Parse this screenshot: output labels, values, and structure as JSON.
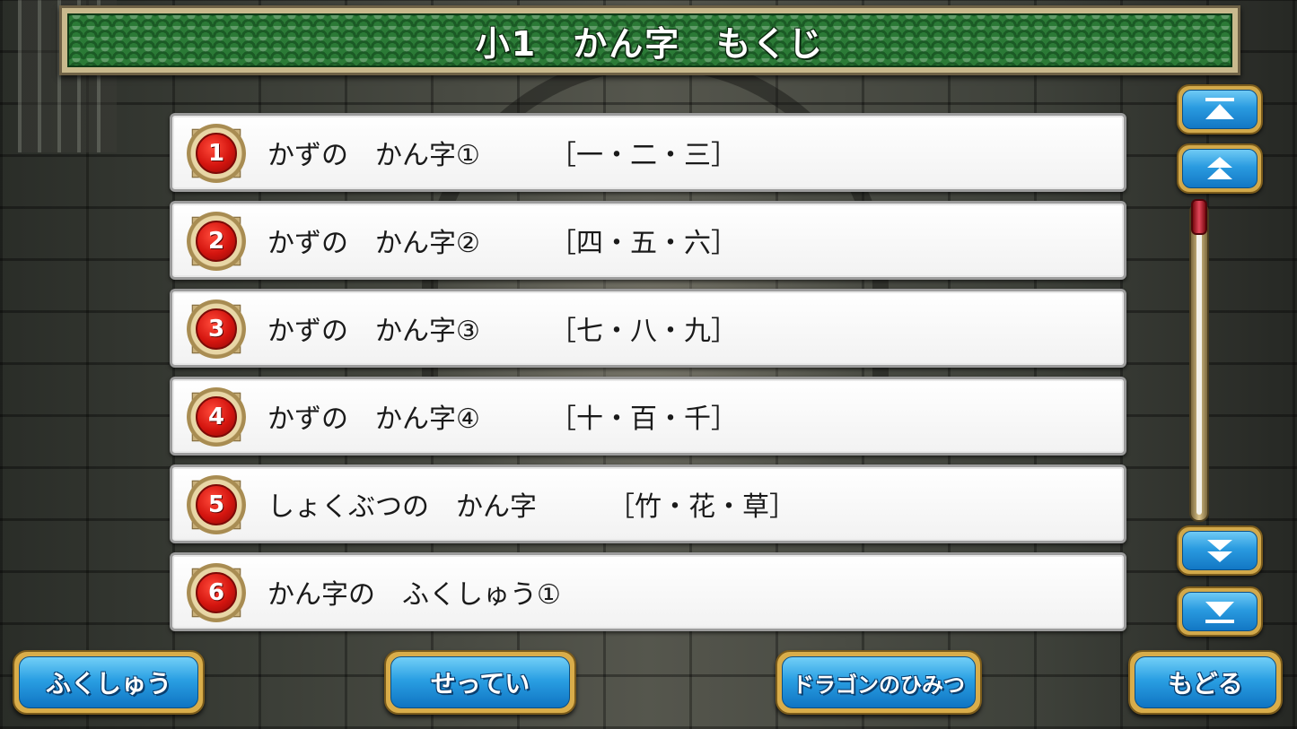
{
  "header": {
    "title": "小1　かん字　もくじ"
  },
  "lessons": [
    {
      "number": "1",
      "title": "かずの　かん字①",
      "kanji": "［一・二・三］"
    },
    {
      "number": "2",
      "title": "かずの　かん字②",
      "kanji": "［四・五・六］"
    },
    {
      "number": "3",
      "title": "かずの　かん字③",
      "kanji": "［七・八・九］"
    },
    {
      "number": "4",
      "title": "かずの　かん字④",
      "kanji": "［十・百・千］"
    },
    {
      "number": "5",
      "title": "しょくぶつの　かん字",
      "kanji": "［竹・花・草］"
    },
    {
      "number": "6",
      "title": "かん字の　ふくしゅう①",
      "kanji": ""
    }
  ],
  "scroll": {
    "top_icon": "double-up-bar-icon",
    "page_up_icon": "double-chevron-up-icon",
    "page_down_icon": "double-chevron-down-icon",
    "bottom_icon": "double-down-bar-icon",
    "position": 0
  },
  "footer": {
    "review_label": "ふくしゅう",
    "settings_label": "せってい",
    "dragon_label": "ドラゴンのひみつ",
    "back_label": "もどる"
  },
  "colors": {
    "banner_green": "#1f6a2c",
    "button_blue": "#2a9be0",
    "button_gold": "#d2a94b",
    "badge_red": "#d4150f"
  }
}
